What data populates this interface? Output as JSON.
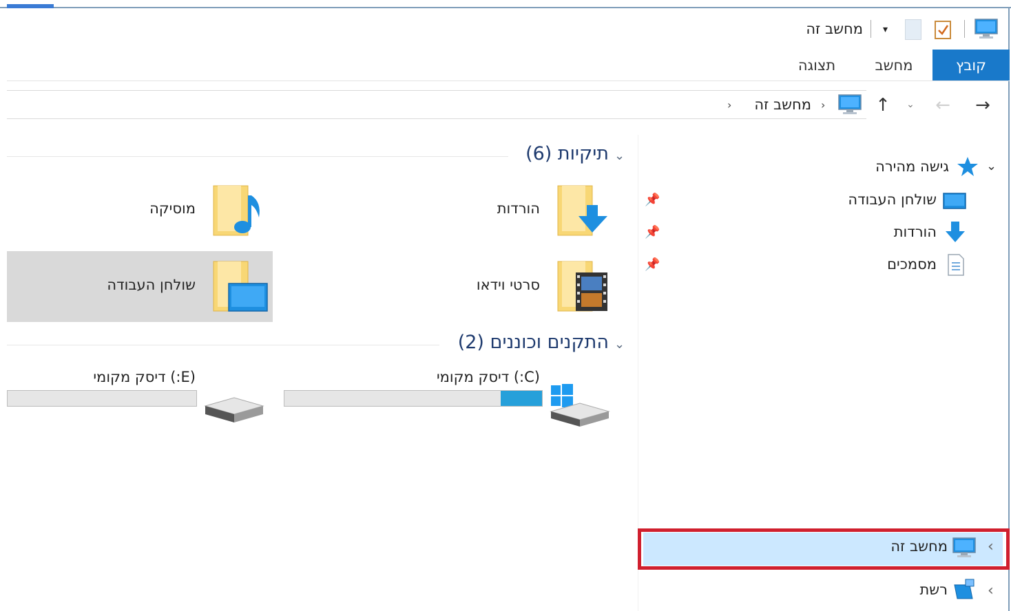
{
  "window": {
    "title": "מחשב זה",
    "quick_access_toolbar": {
      "dropdown_glyph": "▾",
      "icons": [
        "computer-icon",
        "properties-icon",
        "blank-page-icon"
      ]
    }
  },
  "ribbon": {
    "tabs": [
      {
        "label": "קובץ",
        "active": true
      },
      {
        "label": "מחשב",
        "active": false
      },
      {
        "label": "תצוגה",
        "active": false
      }
    ]
  },
  "address_bar": {
    "back_glyph": "→",
    "forward_glyph": "←",
    "recent_glyph": "⌄",
    "up_glyph": "↑",
    "separator_glyph": "›",
    "crumbs": [
      "מחשב זה"
    ]
  },
  "navigation_pane": {
    "quick_access_label": "גישה מהירה",
    "quick_access_chevron": "⌄",
    "pinned_items": [
      {
        "label": "שולחן העבודה",
        "icon": "desktop-icon"
      },
      {
        "label": "הורדות",
        "icon": "downloads-icon"
      },
      {
        "label": "מסמכים",
        "icon": "documents-icon"
      }
    ],
    "pin_glyph": "📌",
    "this_pc_label": "מחשב זה",
    "network_label": "רשת",
    "expand_glyph": "‹"
  },
  "content": {
    "folders_header": "תיקיות (6)",
    "devices_header": "התקנים וכוננים (2)",
    "header_chevron": "⌄",
    "folders": [
      {
        "label": "הורדות",
        "icon": "downloads-folder-icon"
      },
      {
        "label": "מוסיקה",
        "icon": "music-folder-icon"
      },
      {
        "label": "סרטי וידאו",
        "icon": "videos-folder-icon"
      },
      {
        "label": "שולחן העבודה",
        "icon": "desktop-folder-icon",
        "selected": true
      }
    ],
    "drives": [
      {
        "label": "(C:) דיסק מקומי",
        "used_fraction": 0.16,
        "icon": "windows-drive-icon"
      },
      {
        "label": "(E:) דיסק מקומי",
        "used_fraction": 0.0,
        "icon": "drive-icon"
      }
    ]
  },
  "colors": {
    "accent": "#1979ca",
    "selection": "#cce8ff",
    "highlight_box": "#d01f2e",
    "drive_fill": "#26a0da",
    "folder_yellow": "#f8d775"
  }
}
